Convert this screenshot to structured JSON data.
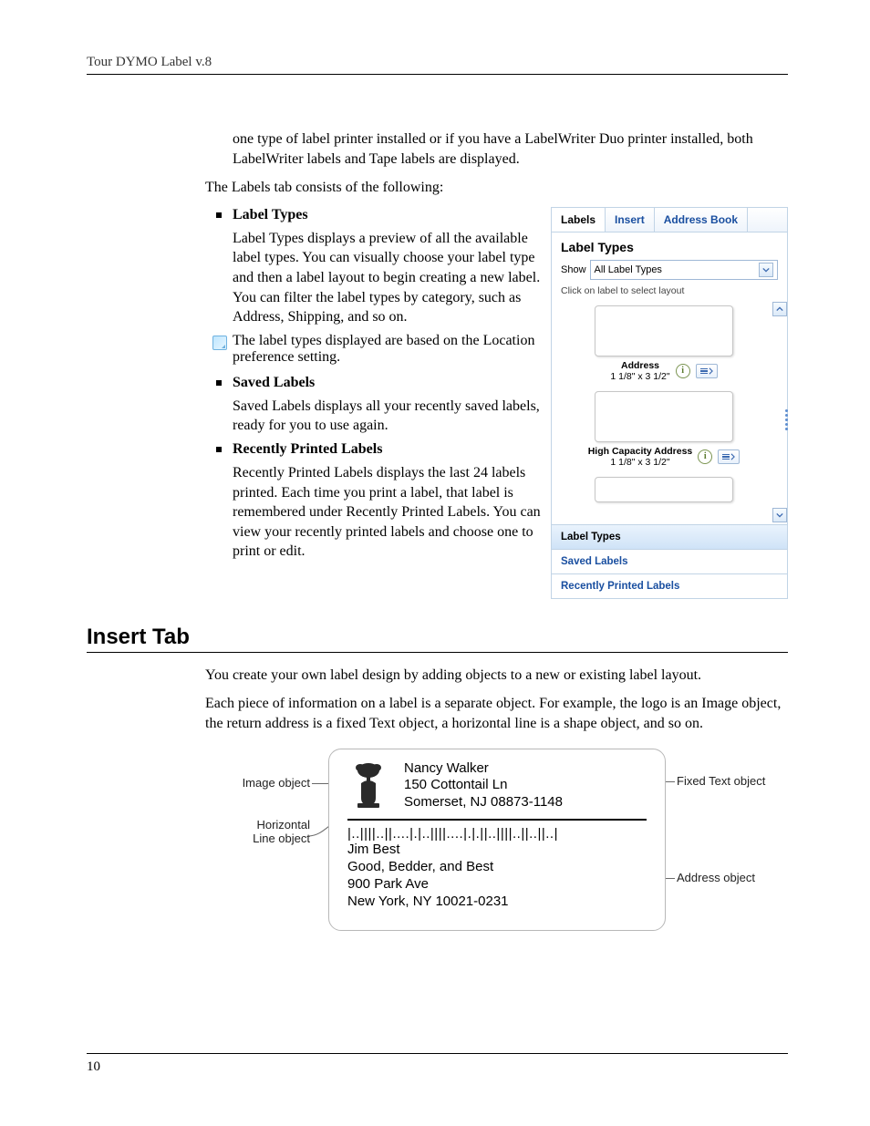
{
  "header": {
    "running_head": "Tour DYMO Label v.8"
  },
  "intro": {
    "p0": "one type of label printer installed or if you have a LabelWriter Duo printer installed, both LabelWriter labels and Tape labels are displayed.",
    "p1": "The Labels tab consists of the following:"
  },
  "bullets": {
    "label_types": {
      "title": "Label Types",
      "body": "Label Types displays a preview of all the available label types. You can visually choose your label type and then a label layout to begin creating a new label. You can filter the label types by category, such as Address, Shipping, and so on.",
      "note": "The label types displayed are based on the Location preference setting."
    },
    "saved_labels": {
      "title": "Saved Labels",
      "body": "Saved Labels displays all your recently saved labels, ready for you to use again."
    },
    "recently_printed": {
      "title": "Recently Printed Labels",
      "body": "Recently Printed Labels displays the last 24 labels printed. Each time you print a label, that label is remembered under Recently Printed Labels. You can view your recently printed labels and choose one to print or edit."
    }
  },
  "panel": {
    "tabs": {
      "labels": "Labels",
      "insert": "Insert",
      "address_book": "Address Book"
    },
    "heading": "Label Types",
    "show_label": "Show",
    "show_value": "All Label Types",
    "caption": "Click on label to select layout",
    "items": [
      {
        "name": "Address",
        "dim": "1 1/8\" x 3 1/2\""
      },
      {
        "name": "High Capacity Address",
        "dim": "1 1/8\" x 3 1/2\""
      }
    ],
    "accordion": {
      "label_types": "Label Types",
      "saved": "Saved Labels",
      "recent": "Recently Printed Labels"
    }
  },
  "section2": {
    "heading": "Insert Tab",
    "p1": "You create your own label design by adding objects to a new or existing label layout.",
    "p2": "Each piece of information on a label is a separate object. For example, the logo is an Image object, the return address is a fixed Text object, a horizontal line is a shape object, and so on."
  },
  "diagram": {
    "labels": {
      "image": "Image object",
      "hline": "Horizontal\nLine object",
      "fixed_text": "Fixed Text object",
      "address": "Address object"
    },
    "sender": {
      "name": "Nancy Walker",
      "street": "150 Cottontail Ln",
      "city": "Somerset, NJ 08873-1148"
    },
    "recipient": {
      "name": "Jim Best",
      "company": "Good, Bedder, and Best",
      "street": "900 Park Ave",
      "city": "New York, NY 10021-0231"
    }
  },
  "page_number": "10"
}
